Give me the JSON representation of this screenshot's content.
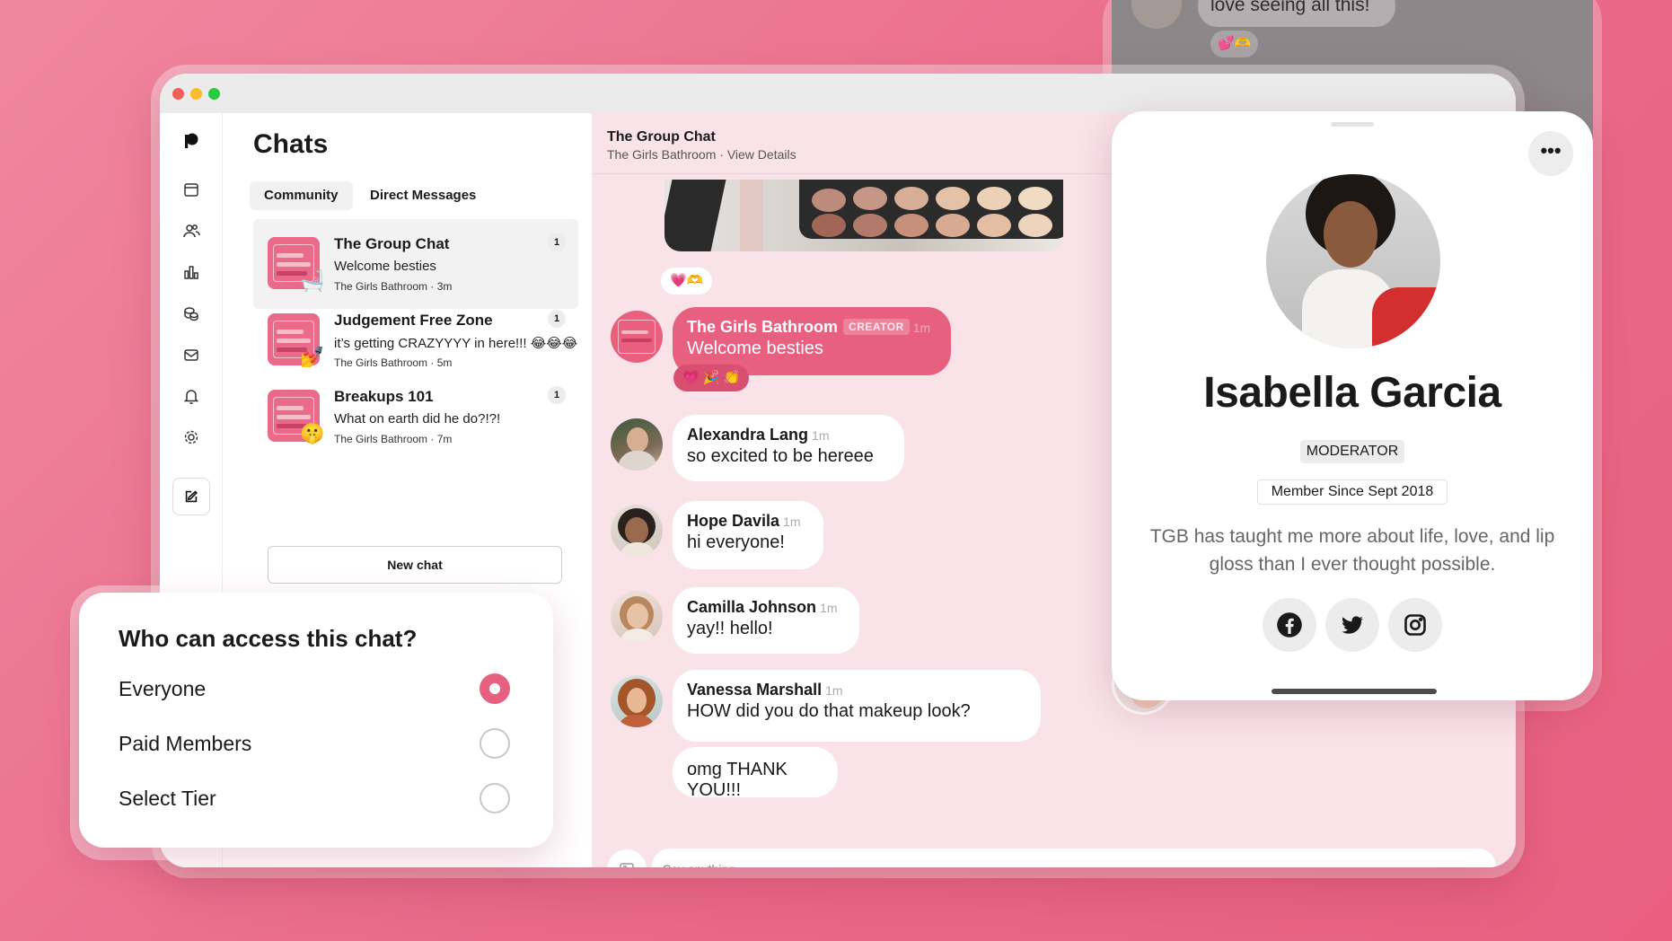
{
  "colors": {
    "accent": "#e8607f",
    "background": "#ee7895",
    "conversation_bg": "#f9e2e8"
  },
  "underlay": {
    "text": "love seeing all this!",
    "reaction": "💕🫶"
  },
  "rail": {
    "icons": [
      "patreon-logo-icon",
      "calendar-icon",
      "people-icon",
      "chart-icon",
      "coins-icon",
      "mail-icon",
      "bell-icon",
      "gear-icon",
      "compose-icon"
    ]
  },
  "chats": {
    "title": "Chats",
    "tabs": [
      "Community",
      "Direct Messages"
    ],
    "items": [
      {
        "name": "The Group Chat",
        "preview": "Welcome besties",
        "meta": "The Girls Bathroom · 3m",
        "badge": "1",
        "emoji": "🛁"
      },
      {
        "name": "Judgement Free Zone",
        "preview": "it’s getting CRAZYYYY in here!!! 😂😂😂",
        "meta": "The Girls Bathroom · 5m",
        "badge": "1",
        "emoji": "💅"
      },
      {
        "name": "Breakups 101",
        "preview": "What on earth did he do?!?!",
        "meta": "The Girls Bathroom · 7m",
        "badge": "1",
        "emoji": "🤫"
      }
    ],
    "new_chat_label": "New chat"
  },
  "conversation": {
    "title": "The Group Chat",
    "subtitle": "The Girls Bathroom · View Details",
    "media_reaction": "💗🫶",
    "messages": [
      {
        "name": "The Girls Bathroom",
        "tag": "CREATOR",
        "time": "1m",
        "text": "Welcome besties",
        "reaction": "💗 🎉 👏"
      },
      {
        "name": "Alexandra Lang",
        "time": "1m",
        "text": "so excited to be hereee"
      },
      {
        "name": "Hope Davila",
        "time": "1m",
        "text": "hi everyone!"
      },
      {
        "name": "Camilla Johnson",
        "time": "1m",
        "text": "yay!! hello!"
      },
      {
        "name": "Vanessa Marshall",
        "time": "1m",
        "text": "HOW did you do that makeup look?"
      },
      {
        "name": "",
        "time": "",
        "text": "omg THANK YOU!!!"
      }
    ],
    "composer_placeholder": "Say anything..."
  },
  "profile": {
    "name": "Isabella Garcia",
    "role": "MODERATOR",
    "member_since": "Member Since Sept 2018",
    "bio": "TGB has taught me more about life, love, and lip gloss than I ever thought possible.",
    "more_label": "•••",
    "socials": [
      "facebook-icon",
      "twitter-icon",
      "instagram-icon"
    ]
  },
  "access": {
    "title": "Who can access this chat?",
    "options": [
      {
        "label": "Everyone",
        "selected": true
      },
      {
        "label": "Paid Members",
        "selected": false
      },
      {
        "label": "Select Tier",
        "selected": false
      }
    ]
  }
}
